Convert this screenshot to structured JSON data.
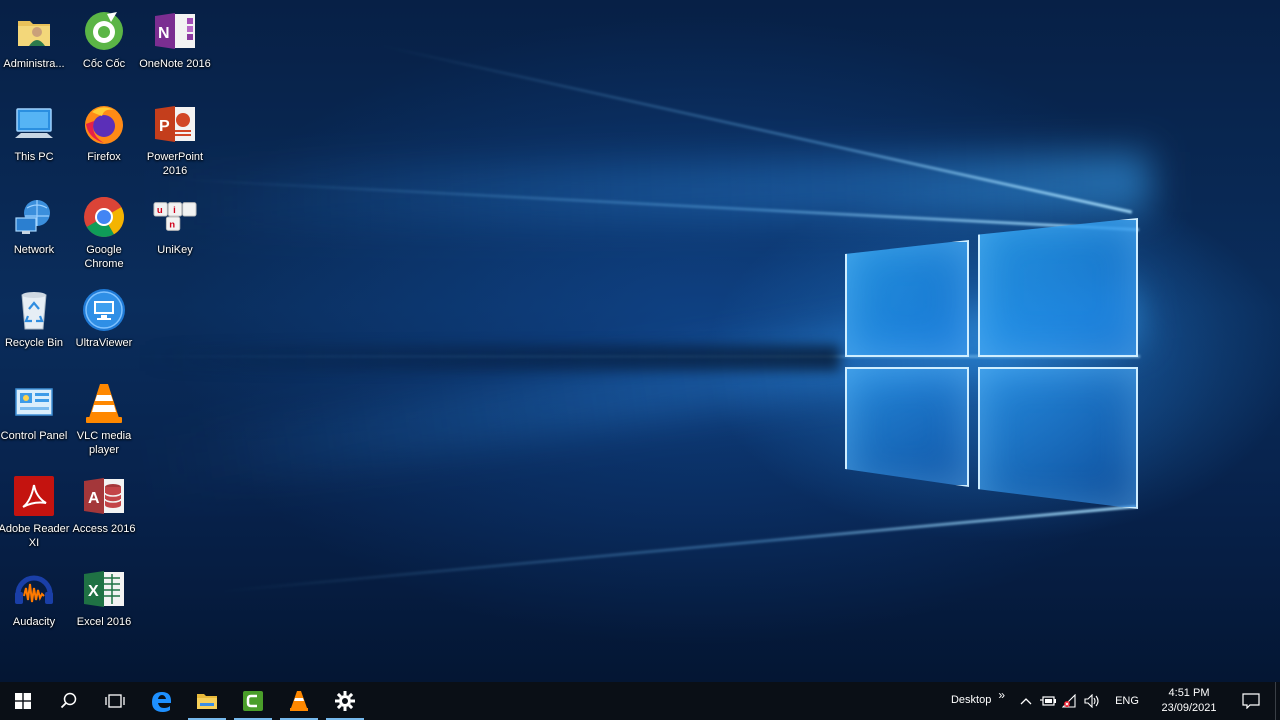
{
  "desktop": {
    "icons": [
      {
        "label": "Administra...",
        "icon": "user-folder-icon"
      },
      {
        "label": "Cốc Cốc",
        "icon": "coccoc-icon"
      },
      {
        "label": "OneNote 2016",
        "icon": "onenote-icon"
      },
      {
        "label": "This PC",
        "icon": "computer-icon"
      },
      {
        "label": "Firefox",
        "icon": "firefox-icon"
      },
      {
        "label": "PowerPoint 2016",
        "icon": "powerpoint-icon"
      },
      {
        "label": "Network",
        "icon": "network-icon"
      },
      {
        "label": "Google Chrome",
        "icon": "chrome-icon"
      },
      {
        "label": "UniKey",
        "icon": "unikey-icon"
      },
      {
        "label": "Recycle Bin",
        "icon": "recycle-bin-icon"
      },
      {
        "label": "UltraViewer",
        "icon": "ultraviewer-icon"
      },
      {
        "label": "Control Panel",
        "icon": "control-panel-icon"
      },
      {
        "label": "VLC media player",
        "icon": "vlc-icon"
      },
      {
        "label": "Adobe Reader XI",
        "icon": "adobe-reader-icon"
      },
      {
        "label": "Access 2016",
        "icon": "access-icon"
      },
      {
        "label": "Audacity",
        "icon": "audacity-icon"
      },
      {
        "label": "Excel 2016",
        "icon": "excel-icon"
      }
    ]
  },
  "taskbar": {
    "buttons": [
      {
        "icon": "windows-start-icon"
      },
      {
        "icon": "search-icon"
      },
      {
        "icon": "task-view-icon"
      },
      {
        "icon": "edge-icon"
      },
      {
        "icon": "file-explorer-icon"
      },
      {
        "icon": "camtasia-icon"
      },
      {
        "icon": "vlc-icon"
      },
      {
        "icon": "settings-gear-icon"
      }
    ],
    "desktop_toolbar_label": "Desktop",
    "toolbar_expand_glyph": "»",
    "language": "ENG",
    "time": "4:51 PM",
    "date": "23/09/2021"
  },
  "colors": {
    "accent": "#76b9ed",
    "taskbar": "#0a0f16",
    "wallpaper": "#0a2d5c"
  }
}
